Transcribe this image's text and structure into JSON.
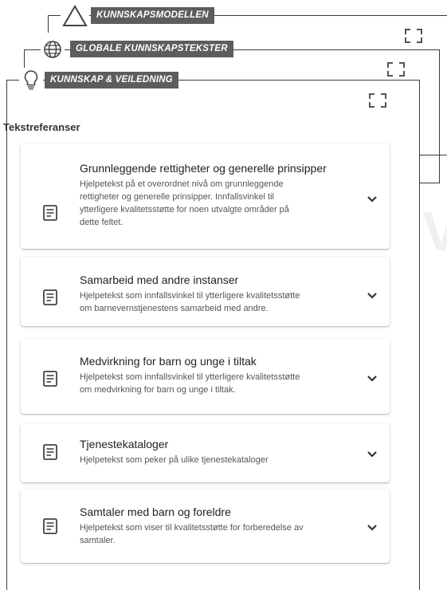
{
  "panels": [
    {
      "label": "KUNNSKAPSMODELLEN",
      "icon": "triangle-icon"
    },
    {
      "label": "GLOBALE KUNNSKAPSTEKSTER",
      "icon": "globe-icon"
    },
    {
      "label": "KUNNSKAP & VEILEDNING",
      "icon": "lightbulb-icon"
    }
  ],
  "section_title": "Tekstreferanser",
  "cards": [
    {
      "title": "Grunnleggende rettigheter og generelle prinsipper",
      "lines": [
        "Hjelpetekst på et overordnet nivå om grunnleggende",
        "rettigheter og generelle prinsipper. Innfallsvinkel til",
        "ytterligere kvalitetsstøtte for noen utvalgte områder på",
        "dette feltet."
      ]
    },
    {
      "title": "Samarbeid med andre instanser",
      "lines": [
        "Hjelpetekst som innfallsvinkel til ytterligere kvalitetsstøtte",
        "om barnevernstjenestens samarbeid med andre."
      ]
    },
    {
      "title": "Medvirkning for barn og unge i tiltak",
      "lines": [
        "Hjelpetekst som innfallsvinkel til ytterligere kvalitetsstøtte",
        "om medvirkning for barn og unge i tiltak."
      ]
    },
    {
      "title": "Tjenestekataloger",
      "lines": [
        "Hjelpetekst som peker på ulike tjenestekataloger"
      ]
    },
    {
      "title": "Samtaler med barn og foreldre",
      "lines": [
        "Hjelpetekst som viser til kvalitetsstøtte for forberedelse av",
        "samtaler."
      ]
    }
  ],
  "colors": {
    "tag_bg": "#5d5d5d",
    "frame": "#3a3a3a"
  }
}
